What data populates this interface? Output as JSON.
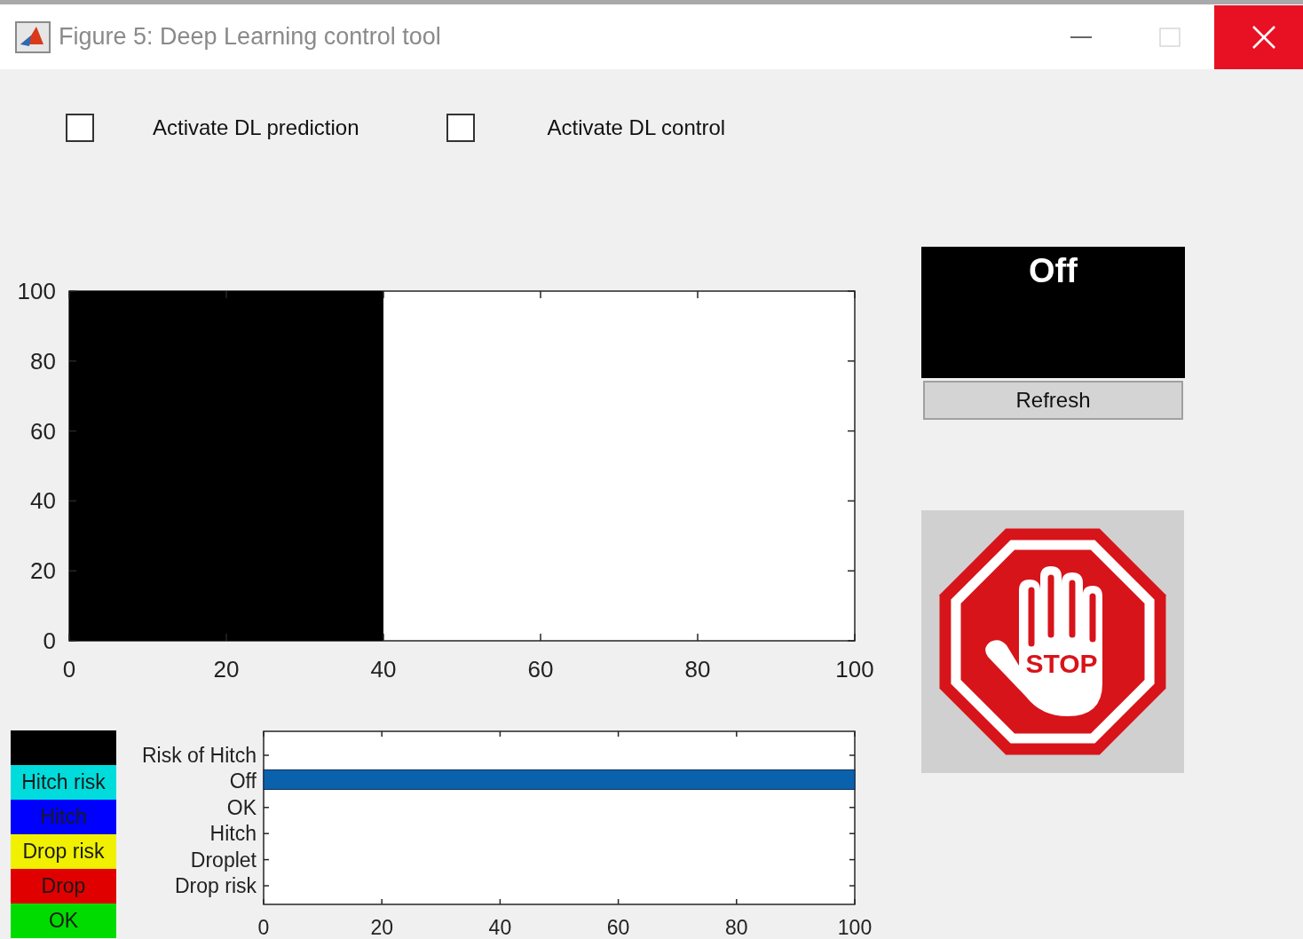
{
  "window": {
    "title": "Figure 5: Deep Learning control tool"
  },
  "checkboxes": [
    {
      "label": "Activate DL prediction",
      "checked": false
    },
    {
      "label": "Activate DL control",
      "checked": false
    }
  ],
  "status_panel": {
    "text": "Off"
  },
  "refresh_button": {
    "label": "Refresh"
  },
  "stop_button": {
    "label": "STOP"
  },
  "main_chart": {
    "chart_data": {
      "type": "bar",
      "x": [
        20
      ],
      "values": [
        100
      ],
      "xlim": [
        0,
        100
      ],
      "ylim": [
        0,
        100
      ],
      "xticks": [
        0,
        20,
        40,
        60,
        80,
        100
      ],
      "yticks": [
        0,
        20,
        40,
        60,
        80,
        100
      ]
    }
  },
  "legend": [
    {
      "color": "#000000"
    },
    {
      "label": "Hitch risk",
      "color": "#00dcdc"
    },
    {
      "label": "Hitch",
      "color": "#0000ff"
    },
    {
      "label": "Drop risk",
      "color": "#f0f000"
    },
    {
      "label": "Drop",
      "color": "#e00000"
    },
    {
      "label": "OK",
      "color": "#00dc00"
    }
  ],
  "state_chart": {
    "chart_data": {
      "type": "bar",
      "orientation": "horizontal",
      "categories": [
        "Risk of Hitch",
        "Off",
        "OK",
        "Hitch",
        "Droplet",
        "Drop risk"
      ],
      "values": [
        0,
        100,
        0,
        0,
        0,
        0
      ],
      "xlim": [
        0,
        100
      ],
      "xticks": [
        0,
        20,
        40,
        60,
        80,
        100
      ]
    }
  }
}
